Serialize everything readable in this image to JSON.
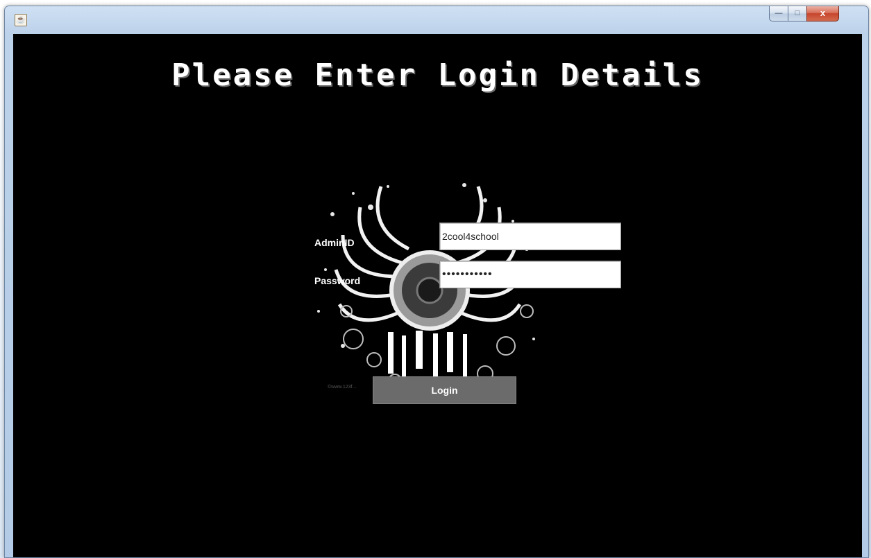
{
  "window": {
    "icon": "java-cup-icon",
    "controls": {
      "minimize": "—",
      "maximize": "□",
      "close": "x"
    }
  },
  "form": {
    "heading": "Please Enter Login Details",
    "admin_label": "AdminID",
    "admin_value": "2cool4school",
    "password_label": "Password",
    "password_value": "•••••••••••",
    "login_label": "Login"
  },
  "artwork": {
    "icon": "speaker-wings-graphic",
    "watermark": "©www.123f..."
  },
  "colors": {
    "background": "#000000",
    "button": "#6b6b6b",
    "text": "#ffffff"
  }
}
